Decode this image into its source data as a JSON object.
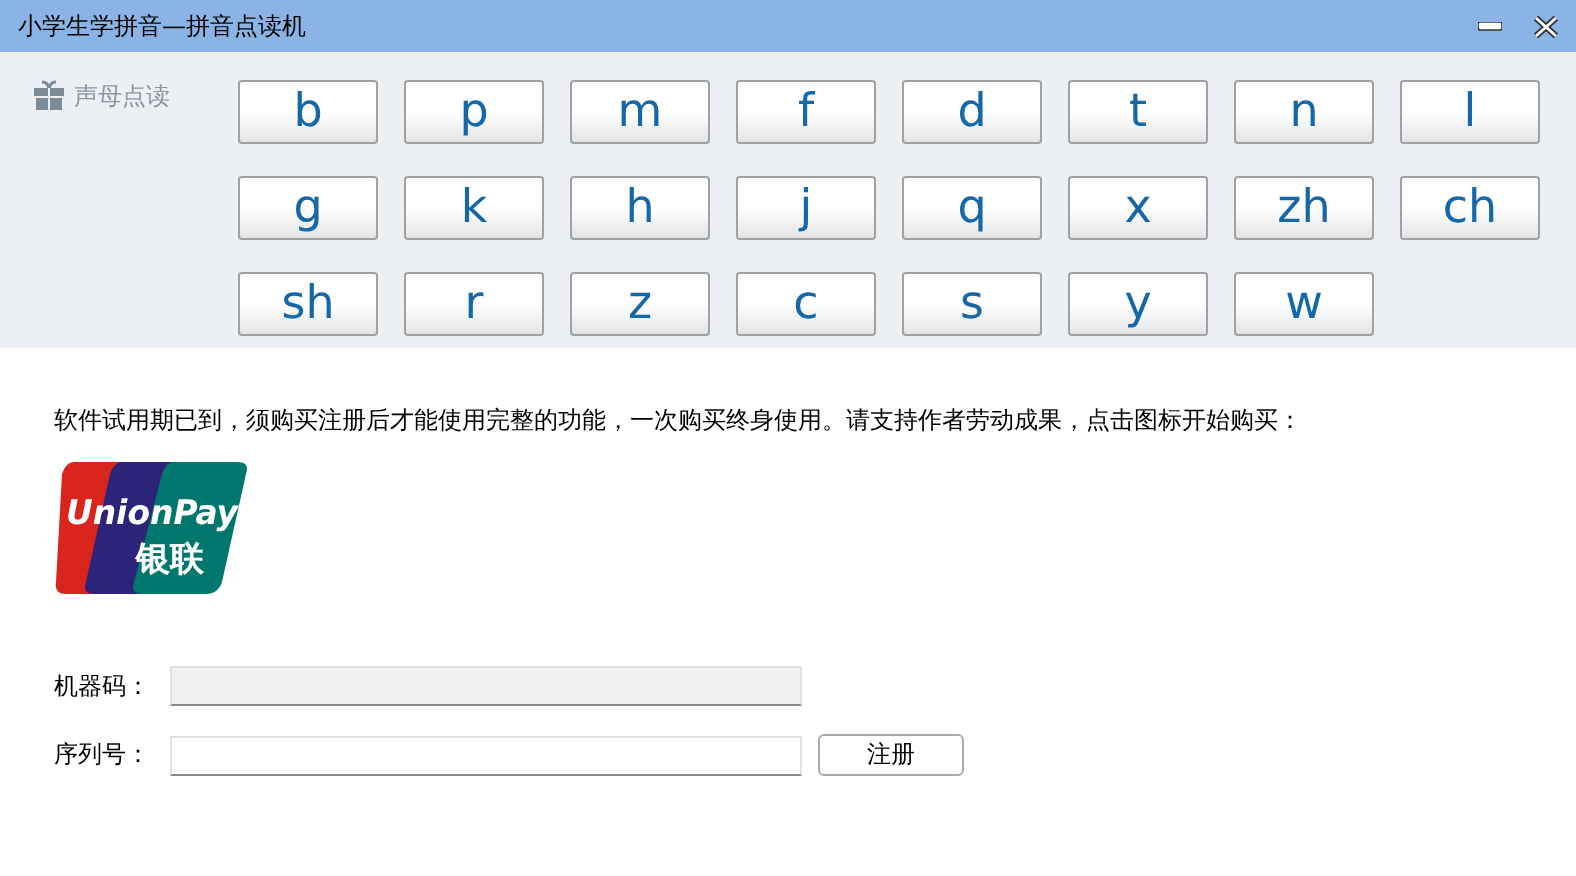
{
  "window": {
    "title": "小学生学拼音—拼音点读机"
  },
  "sidebar": {
    "label": "声母点读"
  },
  "letters": [
    "b",
    "p",
    "m",
    "f",
    "d",
    "t",
    "n",
    "l",
    "g",
    "k",
    "h",
    "j",
    "q",
    "x",
    "zh",
    "ch",
    "sh",
    "r",
    "z",
    "c",
    "s",
    "y",
    "w"
  ],
  "notice": "软件试用期已到，须购买注册后才能使用完整的功能，一次购买终身使用。请支持作者劳动成果，点击图标开始购买：",
  "logo": {
    "text": "UnionPay",
    "subtext": "银联"
  },
  "form": {
    "fields": [
      {
        "label": "机器码：",
        "disabled": true
      },
      {
        "label": "序列号：",
        "disabled": false
      }
    ],
    "button": "注册"
  }
}
